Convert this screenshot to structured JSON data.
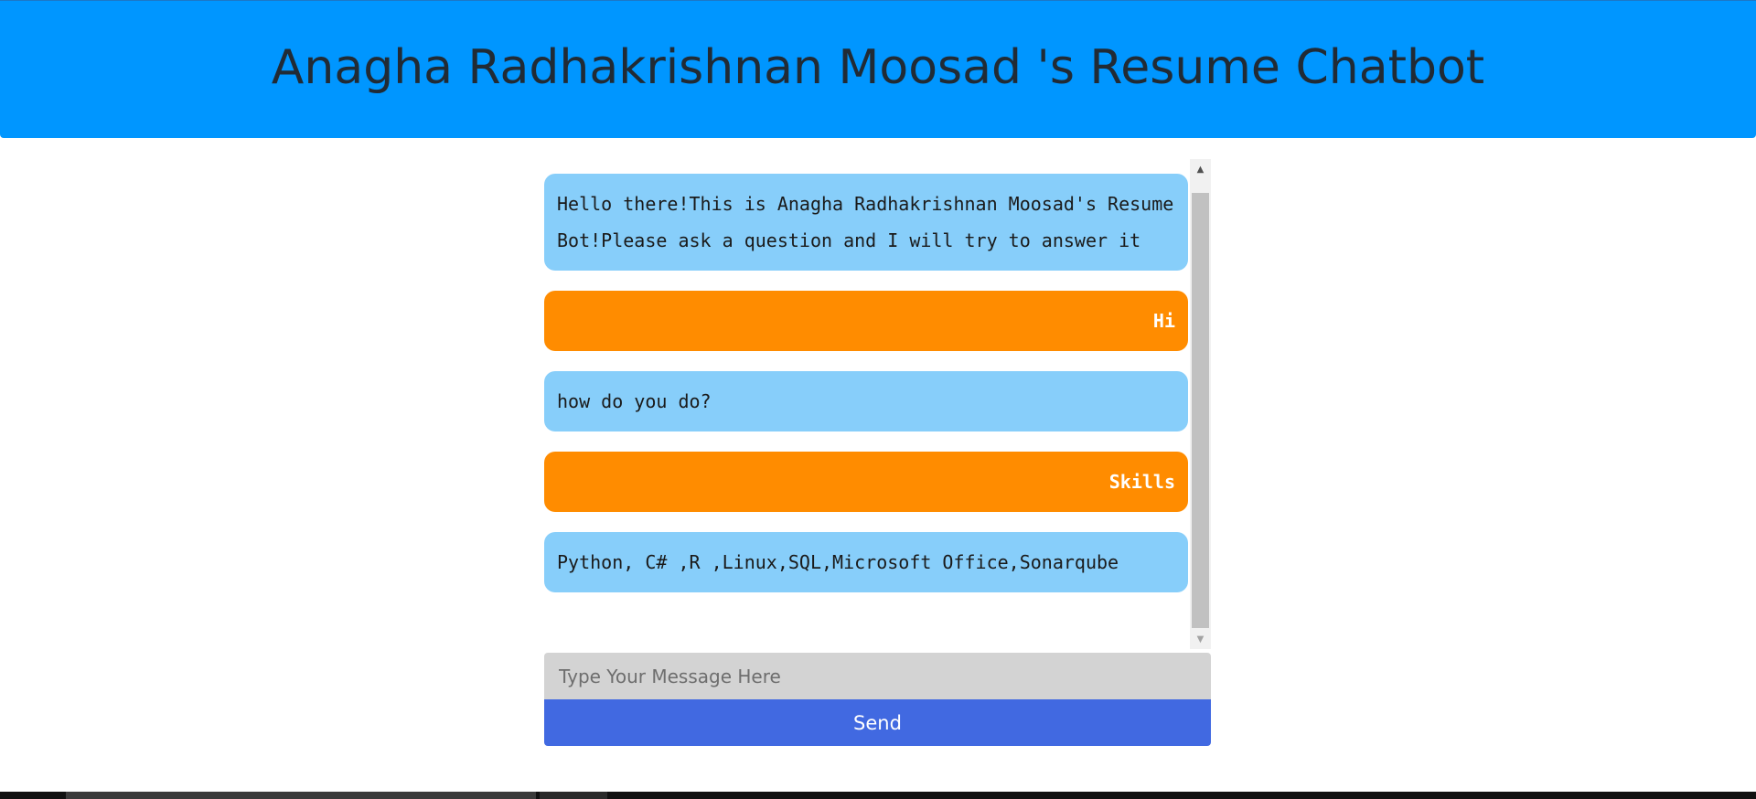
{
  "header": {
    "title": "Anagha Radhakrishnan Moosad 's Resume Chatbot"
  },
  "chat": {
    "messages": [
      {
        "sender": "bot",
        "text": "Hello there!This is Anagha Radhakrishnan Moosad's Resume Bot!Please ask a question and I will try to answer it"
      },
      {
        "sender": "user",
        "text": "Hi"
      },
      {
        "sender": "bot",
        "text": "how do you do?"
      },
      {
        "sender": "user",
        "text": "Skills"
      },
      {
        "sender": "bot",
        "text": "Python, C# ,R ,Linux,SQL,Microsoft Office,Sonarqube"
      }
    ]
  },
  "input": {
    "placeholder": "Type Your Message Here",
    "value": ""
  },
  "send_button": {
    "label": "Send"
  },
  "colors": {
    "header_bg": "#0096ff",
    "bot_bubble": "#87cefa",
    "user_bubble": "#ff8c00",
    "send_button": "#4169e1",
    "input_bg": "#d3d3d3"
  },
  "icons": {
    "scroll_up": "scroll-up-arrow-icon",
    "scroll_down": "scroll-down-arrow-icon"
  }
}
